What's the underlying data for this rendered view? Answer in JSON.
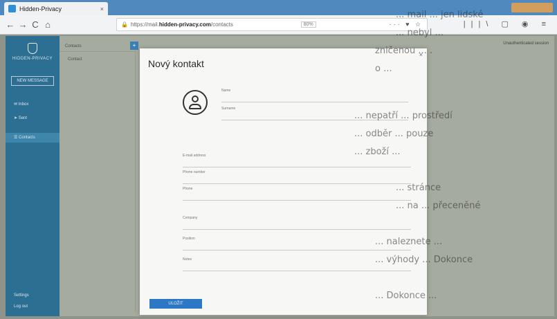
{
  "browser": {
    "tab_title": "Hidden-Privacy",
    "tab_close": "×",
    "url_prefix": "https://mail.",
    "url_host": "hidden-privacy.com",
    "url_path": "/contacts",
    "zoom": "80%",
    "url_actions": "··· ♥ ☆",
    "nav_back": "←",
    "nav_forward": "→",
    "nav_reload": "C",
    "nav_home": "⌂",
    "nav_right": "|||\\ ▢ ◉ ≡",
    "lock": "🔒"
  },
  "sidebar": {
    "brand": "HIDDEN-PRIVACY",
    "new_button": "NEW MESSAGE",
    "items": [
      {
        "label": "✉ Inbox"
      },
      {
        "label": "➤ Sent"
      },
      {
        "label": "☰ Contacts"
      }
    ],
    "bottom": [
      "Settings",
      "Log out"
    ]
  },
  "main": {
    "list_header": "Contacts",
    "list_rows": [
      "Contact"
    ],
    "topright": "Unauthenticated session",
    "badge": "+"
  },
  "modal": {
    "title": "Nový kontakt",
    "close": "×",
    "fields": [
      {
        "label": "Name",
        "value": ""
      },
      {
        "label": "Surname",
        "value": ""
      },
      {
        "label": "E-mail address",
        "value": ""
      },
      {
        "label": "Phone number",
        "value": ""
      },
      {
        "label": "Phone",
        "value": ""
      },
      {
        "label": "Company",
        "value": ""
      },
      {
        "label": "Position",
        "value": ""
      },
      {
        "label": "Notes",
        "value": ""
      }
    ],
    "save_label": "ULOŽIT"
  },
  "paper_lines": [
    "... mail ... jen lidské",
    "... nebyl ...",
    "zničenou ... .",
    "o ...",
    "... nepatří ... prostředí",
    "... odběr ... pouze",
    "... zboží ...",
    "... stránce",
    "... na ... přeceněné",
    "... naleznete ...",
    "... výhody ... Dokonce",
    "... Dokonce ..."
  ],
  "colors": {
    "tabbar": "#4f89bd",
    "sidebar": "#2c6f93",
    "accent": "#2c78c4"
  }
}
